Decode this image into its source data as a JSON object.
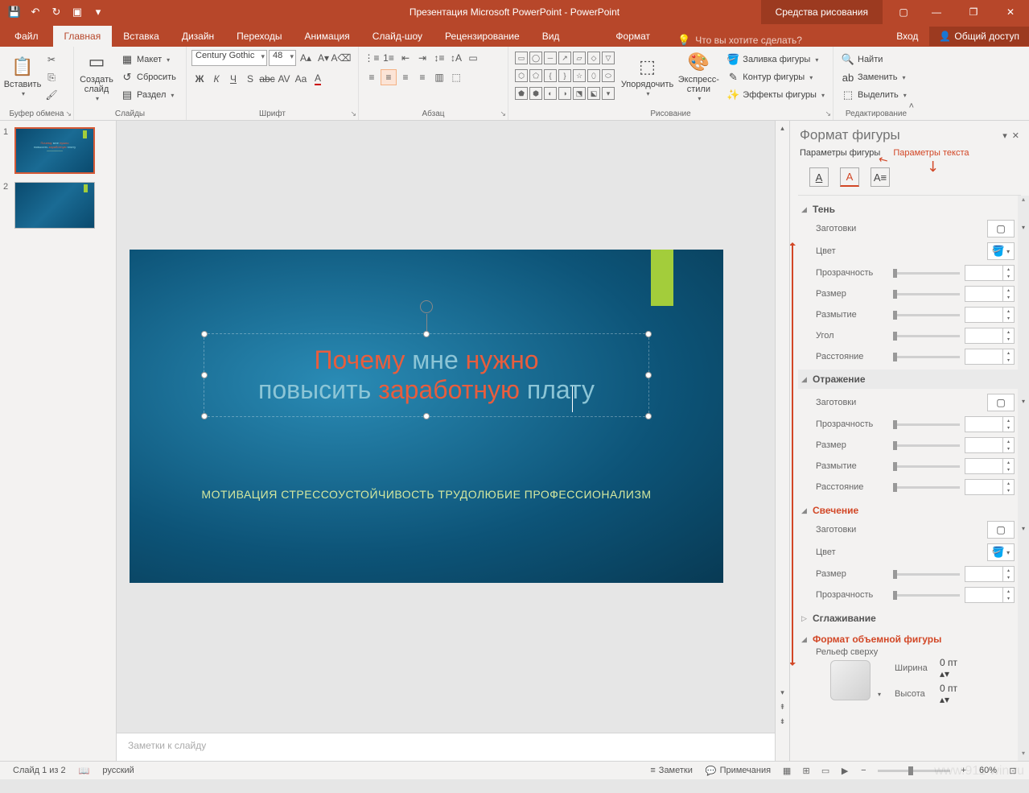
{
  "titlebar": {
    "title": "Презентация Microsoft PowerPoint - PowerPoint",
    "context_tab": "Средства рисования"
  },
  "tabs": {
    "file": "Файл",
    "home": "Главная",
    "insert": "Вставка",
    "design": "Дизайн",
    "transitions": "Переходы",
    "animations": "Анимация",
    "slideshow": "Слайд-шоу",
    "review": "Рецензирование",
    "view": "Вид",
    "format": "Формат",
    "tellme": "Что вы хотите сделать?",
    "signin": "Вход",
    "share": "Общий доступ"
  },
  "ribbon": {
    "clipboard": {
      "paste": "Вставить",
      "label": "Буфер обмена"
    },
    "slides": {
      "new": "Создать слайд",
      "layout": "Макет",
      "reset": "Сбросить",
      "section": "Раздел",
      "label": "Слайды"
    },
    "font": {
      "name": "Century Gothic",
      "size": "48",
      "label": "Шрифт"
    },
    "paragraph": {
      "label": "Абзац"
    },
    "drawing": {
      "arrange": "Упорядочить",
      "quick": "Экспресс-стили",
      "fill": "Заливка фигуры",
      "outline": "Контур фигуры",
      "effects": "Эффекты фигуры",
      "label": "Рисование"
    },
    "editing": {
      "find": "Найти",
      "replace": "Заменить",
      "select": "Выделить",
      "label": "Редактирование"
    }
  },
  "slide": {
    "line1_w1": "Почему",
    "line1_w2": "мне",
    "line1_w3": "нужно",
    "line2_w1": "повысить",
    "line2_w2": "заработную",
    "line2_w3": "плату",
    "subtitle": "МОТИВАЦИЯ СТРЕССОУСТОЙЧИВОСТЬ ТРУДОЛЮБИЕ ПРОФЕССИОНАЛИЗМ"
  },
  "thumbs": {
    "n1": "1",
    "n2": "2"
  },
  "notes": {
    "placeholder": "Заметки к слайду"
  },
  "pane": {
    "title": "Формат фигуры",
    "tab_shape": "Параметры фигуры",
    "tab_text": "Параметры текста",
    "shadow": {
      "head": "Тень",
      "presets": "Заготовки",
      "color": "Цвет",
      "transparency": "Прозрачность",
      "size": "Размер",
      "blur": "Размытие",
      "angle": "Угол",
      "distance": "Расстояние"
    },
    "reflection": {
      "head": "Отражение",
      "presets": "Заготовки",
      "transparency": "Прозрачность",
      "size": "Размер",
      "blur": "Размытие",
      "distance": "Расстояние"
    },
    "glow": {
      "head": "Свечение",
      "presets": "Заготовки",
      "color": "Цвет",
      "size": "Размер",
      "transparency": "Прозрачность"
    },
    "softedges": {
      "head": "Сглаживание"
    },
    "threed": {
      "head": "Формат объемной фигуры",
      "top_bevel": "Рельеф сверху",
      "width": "Ширина",
      "height": "Высота",
      "zero": "0 пт"
    }
  },
  "status": {
    "slide_of": "Слайд 1 из 2",
    "lang": "русский",
    "notes": "Заметки",
    "comments": "Примечания",
    "zoom": "60%"
  },
  "watermark": "www.911-win.ru"
}
